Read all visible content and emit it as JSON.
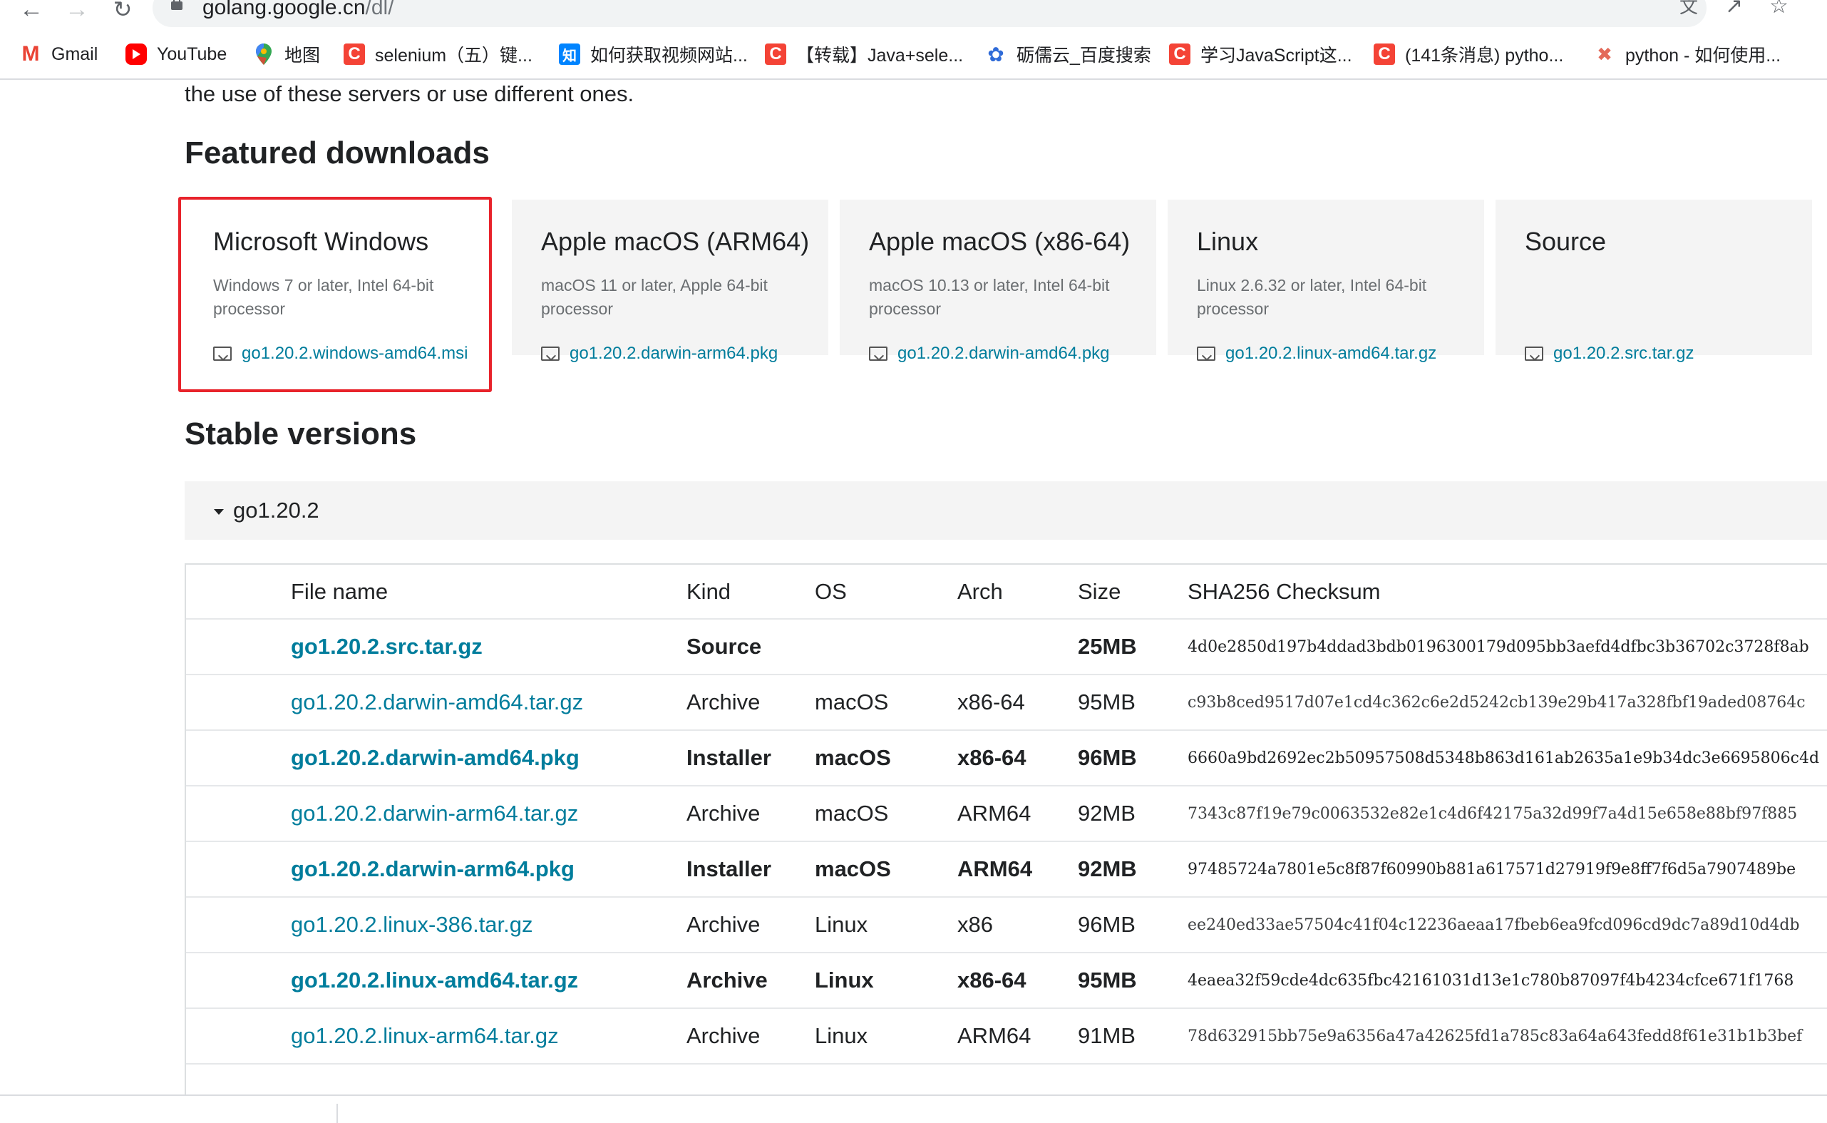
{
  "browser": {
    "url_host": "golang.google.cn",
    "url_path": "/dl/",
    "bookmarks": [
      {
        "label": "Gmail",
        "icon": "gmail-icon"
      },
      {
        "label": "YouTube",
        "icon": "youtube-icon"
      },
      {
        "label": "地图",
        "icon": "maps-icon"
      },
      {
        "label": "selenium（五）键...",
        "icon": "csdn-icon"
      },
      {
        "label": "如何获取视频网站...",
        "icon": "zhihu-icon"
      },
      {
        "label": "【转载】Java+sele...",
        "icon": "csdn-icon"
      },
      {
        "label": "砺儒云_百度搜索",
        "icon": "baidu-icon"
      },
      {
        "label": "学习JavaScript这...",
        "icon": "csdn-icon"
      },
      {
        "label": "(141条消息) pytho...",
        "icon": "csdn-icon"
      },
      {
        "label": "python - 如何使用...",
        "icon": "stackoverflow-icon"
      }
    ]
  },
  "page": {
    "intro_text": "the use of these servers or use different ones.",
    "featured_title": "Featured downloads",
    "stable_title": "Stable versions",
    "highlight_color": "#e8232b",
    "link_color": "#007d9c",
    "featured": [
      {
        "os": "Microsoft Windows",
        "desc": "Windows 7 or later, Intel 64-bit processor",
        "file": "go1.20.2.windows-amd64.msi"
      },
      {
        "os": "Apple macOS (ARM64)",
        "desc": "macOS 11 or later, Apple 64-bit processor",
        "file": "go1.20.2.darwin-arm64.pkg"
      },
      {
        "os": "Apple macOS (x86-64)",
        "desc": "macOS 10.13 or later, Intel 64-bit processor",
        "file": "go1.20.2.darwin-amd64.pkg"
      },
      {
        "os": "Linux",
        "desc": "Linux 2.6.32 or later, Intel 64-bit processor",
        "file": "go1.20.2.linux-amd64.tar.gz"
      },
      {
        "os": "Source",
        "desc": "",
        "file": "go1.20.2.src.tar.gz"
      }
    ],
    "version_label": "go1.20.2",
    "table": {
      "headers": [
        "File name",
        "Kind",
        "OS",
        "Arch",
        "Size",
        "SHA256 Checksum"
      ],
      "rows": [
        {
          "file": "go1.20.2.src.tar.gz",
          "kind": "Source",
          "os": "",
          "arch": "",
          "size": "25MB",
          "sha": "4d0e2850d197b4ddad3bdb0196300179d095bb3aefd4dfbc3b36702c3728f8ab",
          "bold": true
        },
        {
          "file": "go1.20.2.darwin-amd64.tar.gz",
          "kind": "Archive",
          "os": "macOS",
          "arch": "x86-64",
          "size": "95MB",
          "sha": "c93b8ced9517d07e1cd4c362c6e2d5242cb139e29b417a328fbf19aded08764c",
          "bold": false
        },
        {
          "file": "go1.20.2.darwin-amd64.pkg",
          "kind": "Installer",
          "os": "macOS",
          "arch": "x86-64",
          "size": "96MB",
          "sha": "6660a9bd2692ec2b50957508d5348b863d161ab2635a1e9b34dc3e6695806c4d",
          "bold": true
        },
        {
          "file": "go1.20.2.darwin-arm64.tar.gz",
          "kind": "Archive",
          "os": "macOS",
          "arch": "ARM64",
          "size": "92MB",
          "sha": "7343c87f19e79c0063532e82e1c4d6f42175a32d99f7a4d15e658e88bf97f885",
          "bold": false
        },
        {
          "file": "go1.20.2.darwin-arm64.pkg",
          "kind": "Installer",
          "os": "macOS",
          "arch": "ARM64",
          "size": "92MB",
          "sha": "97485724a7801e5c8f87f60990b881a617571d27919f9e8ff7f6d5a7907489be",
          "bold": true
        },
        {
          "file": "go1.20.2.linux-386.tar.gz",
          "kind": "Archive",
          "os": "Linux",
          "arch": "x86",
          "size": "96MB",
          "sha": "ee240ed33ae57504c41f04c12236aeaa17fbeb6ea9fcd096cd9dc7a89d10d4db",
          "bold": false
        },
        {
          "file": "go1.20.2.linux-amd64.tar.gz",
          "kind": "Archive",
          "os": "Linux",
          "arch": "x86-64",
          "size": "95MB",
          "sha": "4eaea32f59cde4dc635fbc42161031d13e1c780b87097f4b4234cfce671f1768",
          "bold": true
        },
        {
          "file": "go1.20.2.linux-arm64.tar.gz",
          "kind": "Archive",
          "os": "Linux",
          "arch": "ARM64",
          "size": "91MB",
          "sha": "78d632915bb75e9a6356a47a42625fd1a785c83a64a643fedd8f61e31b1b3bef",
          "bold": false
        }
      ]
    }
  }
}
